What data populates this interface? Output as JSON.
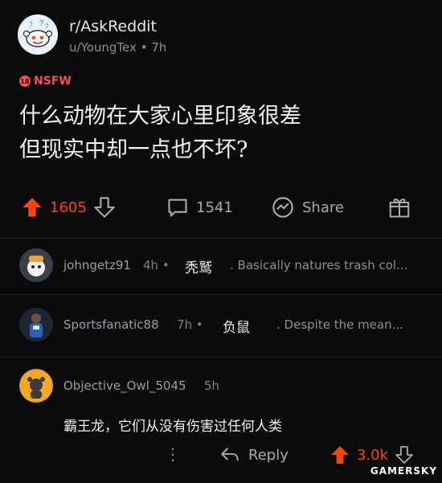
{
  "post": {
    "subreddit": "r/AskReddit",
    "author": "u/YoungTex",
    "time": "7h",
    "meta_separator": "•",
    "nsfw_badge": "18",
    "nsfw_label": "NSFW",
    "title_line1": "什么动物在大家心里印象很差",
    "title_line2": "但现实中却一点也不坏?"
  },
  "actions": {
    "upvotes": "1605",
    "comments": "1541",
    "share": "Share"
  },
  "comments": [
    {
      "author": "johngetz91",
      "time": "4h",
      "separator": "•",
      "translation": "秃鹫",
      "snippet": ". Basically natures trash col..."
    },
    {
      "author": "Sportsfanatic88",
      "time": "7h",
      "separator": "•",
      "translation": "负鼠",
      "snippet": ". Despite the mean..."
    },
    {
      "author": "Objective_Owl_5045",
      "time": "5h",
      "body": "霸王龙，它们从没有伤害过任何人类",
      "reply": "Reply",
      "score": "3.0k"
    }
  ],
  "watermark": "GAMERSKY",
  "colors": {
    "upvote": "#ff4500",
    "nsfw": "#ff4a5a",
    "background": "#0b0b0c"
  }
}
